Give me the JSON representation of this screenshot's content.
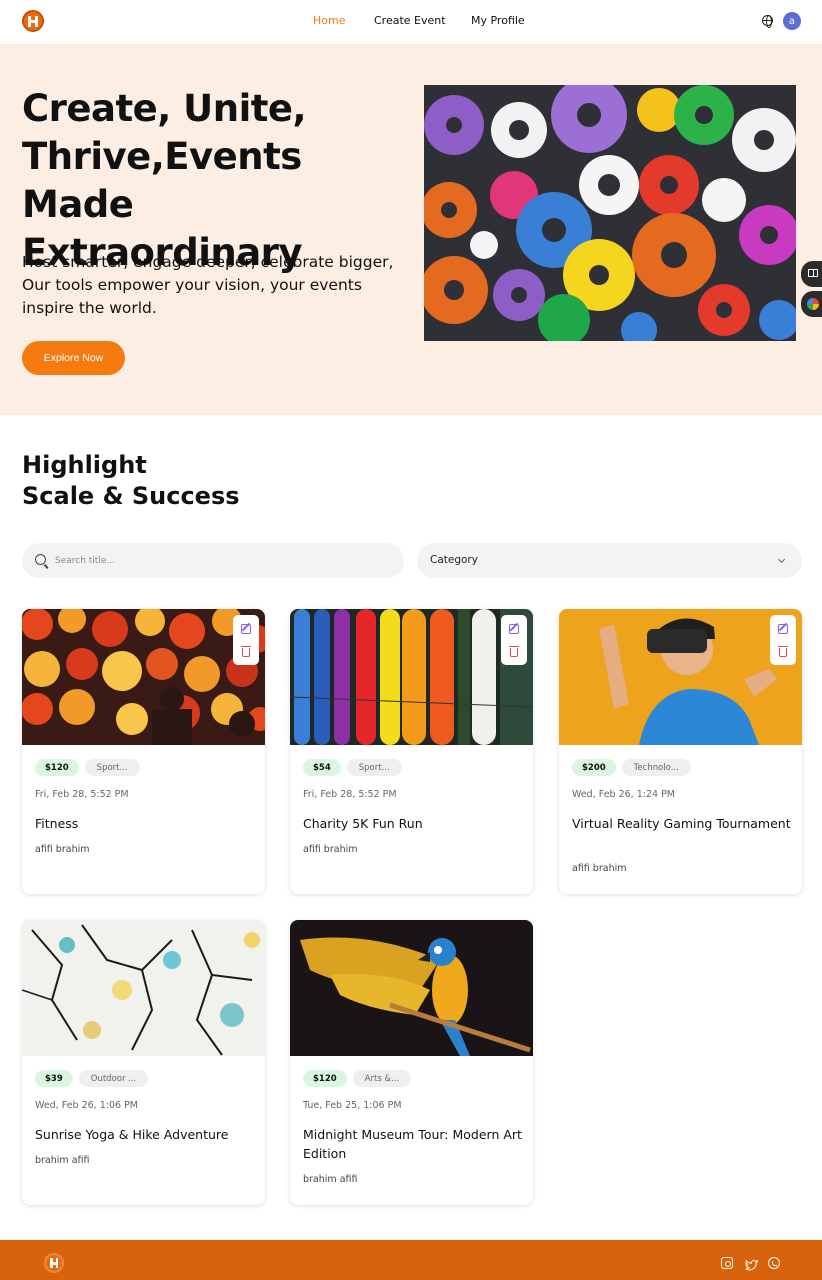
{
  "colors": {
    "accent": "#f57a10",
    "footer": "#d9620c",
    "hero_bg": "#fdeee4",
    "price_badge": "#d9f7e0"
  },
  "nav": {
    "links": [
      "Home",
      "Create Event",
      "My Profile"
    ],
    "active": "Home",
    "avatar_letter": "a"
  },
  "hero": {
    "title": "Create, Unite, Thrive,Events Made Extraordinary",
    "subtitle": "Host smarter, engage deeper, celebrate bigger, Our tools empower your vision, your events inspire the world.",
    "button": "Explore Now"
  },
  "highlight": {
    "title_line1": "Highlight",
    "title_line2": "Scale & Success",
    "search_placeholder": "Search title...",
    "category_label": "Category"
  },
  "events": [
    {
      "price": "$120",
      "category": "Sport...",
      "date": "Fri, Feb 28, 5:52 PM",
      "title": "Fitness",
      "author": "afifi brahim"
    },
    {
      "price": "$54",
      "category": "Sport...",
      "date": "Fri, Feb 28, 5:52 PM",
      "title": "Charity 5K Fun Run",
      "author": "afifi brahim"
    },
    {
      "price": "$200",
      "category": "Technolo...",
      "date": "Wed, Feb 26, 1:24 PM",
      "title": "Virtual Reality Gaming Tournament",
      "author": "afifi brahim"
    },
    {
      "price": "$39",
      "category": "Outdoor ...",
      "date": "Wed, Feb 26, 1:06 PM",
      "title": "Sunrise Yoga & Hike Adventure",
      "author": "brahim afifi"
    },
    {
      "price": "$120",
      "category": "Arts &...",
      "date": "Tue, Feb 25, 1:06 PM",
      "title": "Midnight Museum Tour: Modern Art Edition",
      "author": "brahim afifi"
    }
  ]
}
